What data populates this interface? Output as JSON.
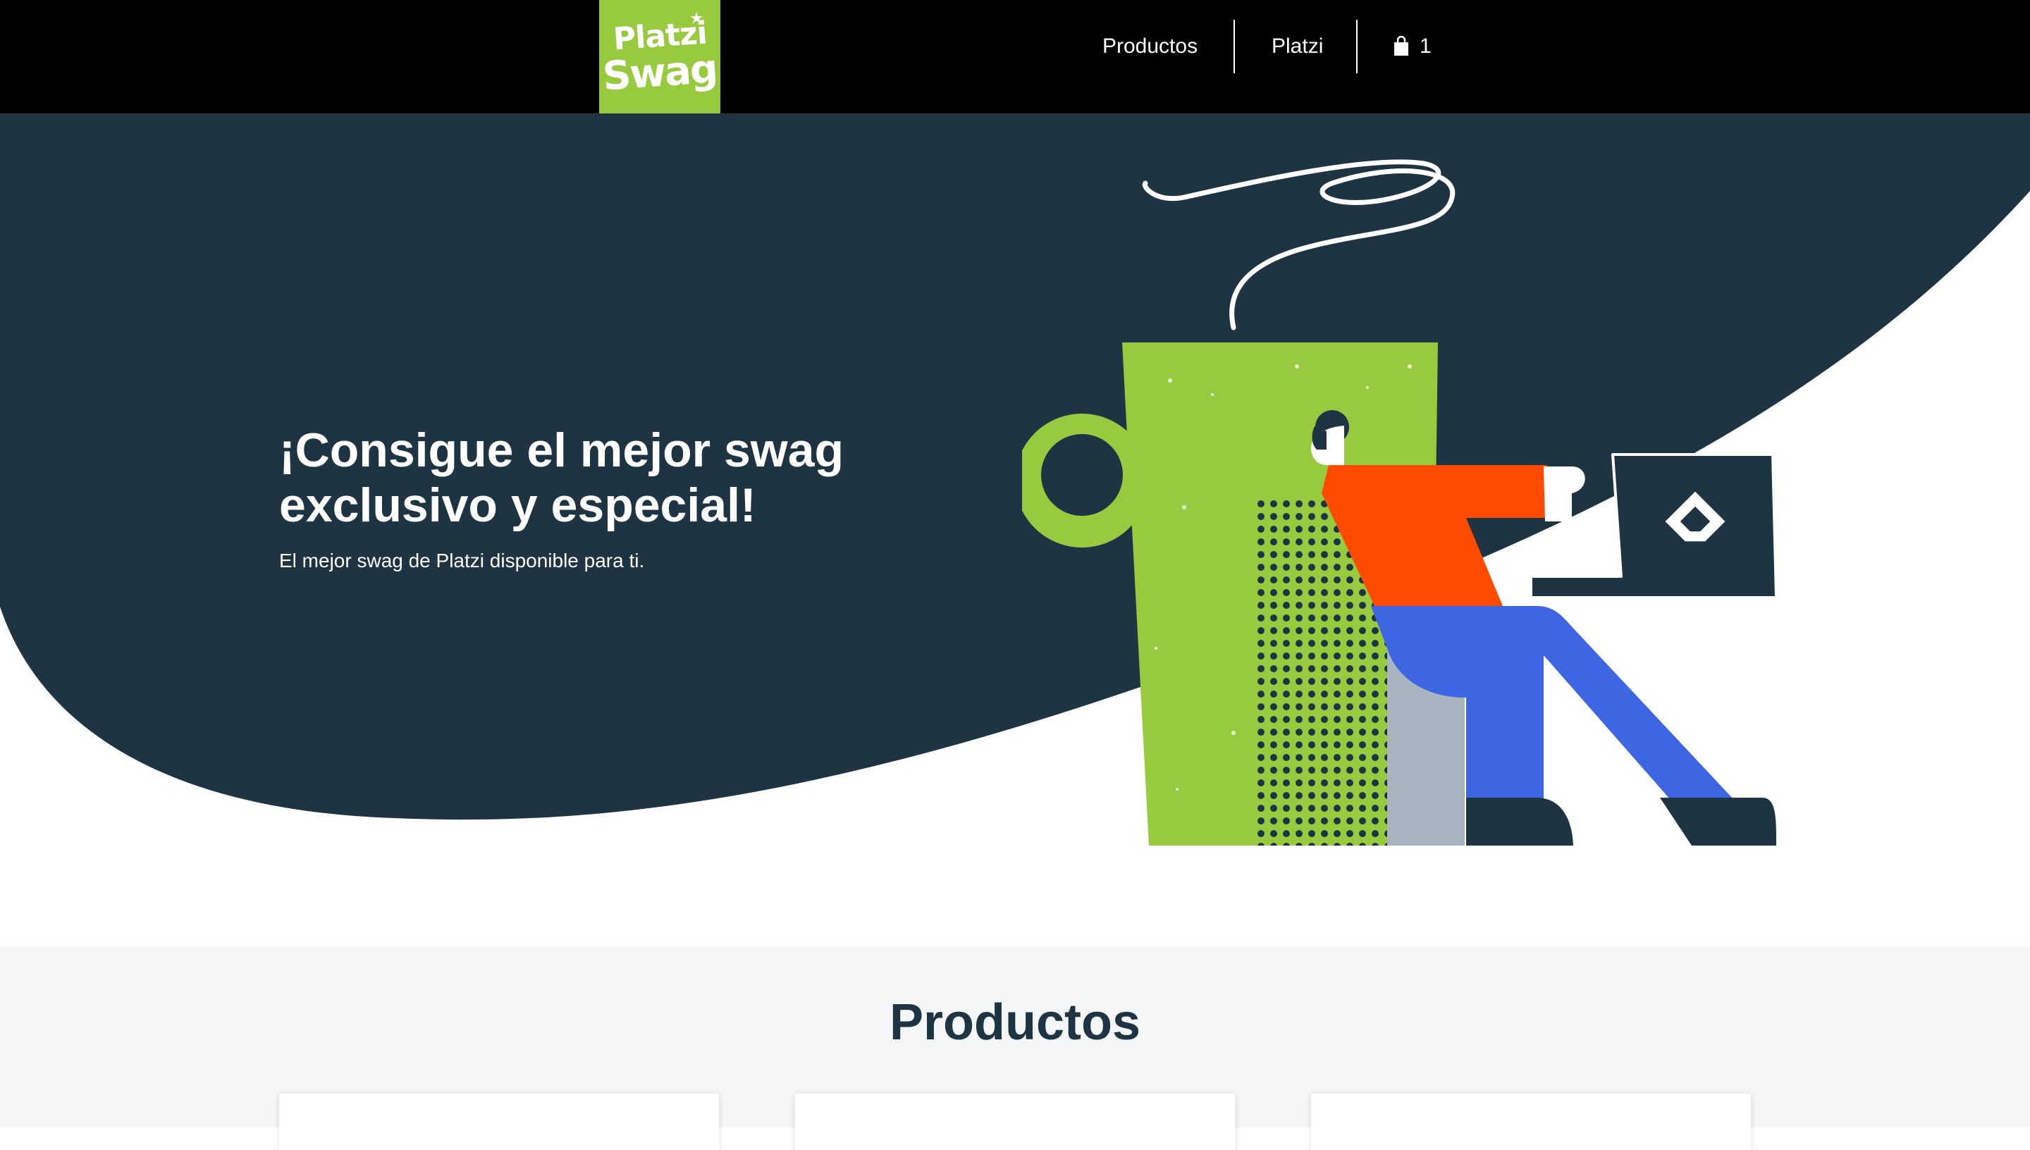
{
  "header": {
    "logo": {
      "line1": "Platzi",
      "line2": "Swag",
      "star": "★"
    },
    "nav": {
      "productos": "Productos",
      "platzi": "Platzi",
      "cart_count": "1"
    }
  },
  "hero": {
    "title": "¡Consigue el mejor swag exclusivo y especial!",
    "subtitle": "El mejor swag de Platzi disponible para ti."
  },
  "products": {
    "title": "Productos",
    "cards": [
      {},
      {},
      {}
    ]
  },
  "colors": {
    "header_bg": "#000000",
    "brand_green": "#98ca3f",
    "hero_dark": "#1e3443",
    "shirt_orange": "#ff4b00",
    "pants_blue": "#3e66e3",
    "products_bg": "#f4f6f8"
  },
  "icons": {
    "cart": "shopping-bag-icon",
    "laptop_logo": "platzi-logo-icon"
  }
}
